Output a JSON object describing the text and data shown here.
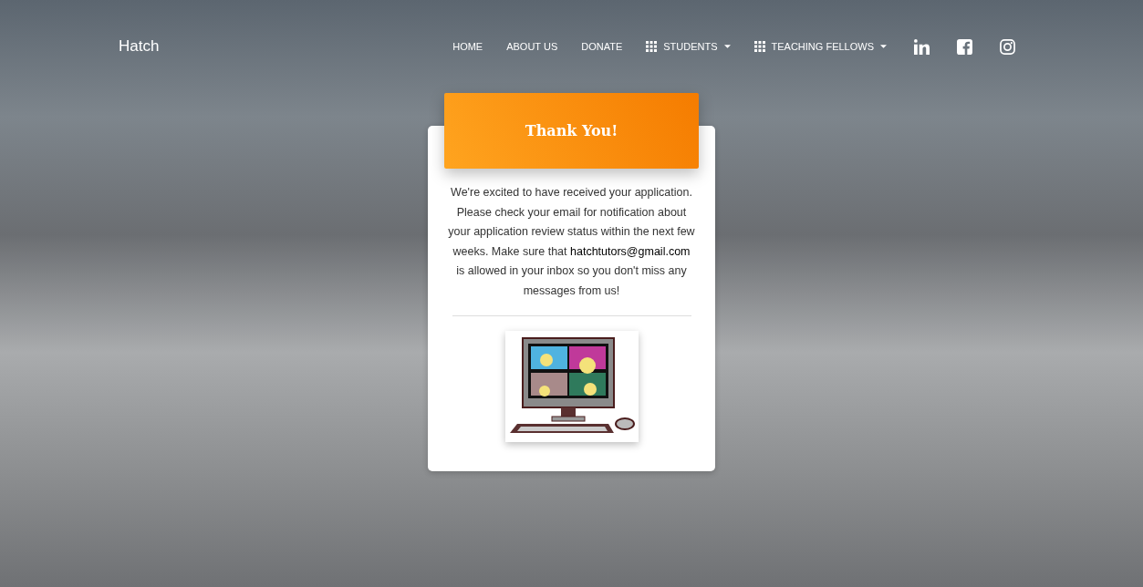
{
  "navbar": {
    "brand": "Hatch",
    "items": [
      {
        "kind": "link",
        "label": "HOME"
      },
      {
        "kind": "link",
        "label": "ABOUT US"
      },
      {
        "kind": "link",
        "label": "DONATE"
      },
      {
        "kind": "dropdown",
        "label": "STUDENTS"
      },
      {
        "kind": "dropdown",
        "label": "TEACHING FELLOWS"
      }
    ]
  },
  "card": {
    "title": "Thank You!",
    "message": "We're excited to have received your application. Please check your email for notification about your application review status within the next few weeks. Make sure that **hatchtutors@gmail.com** is allowed in your inbox so you don't miss any messages from us!"
  }
}
